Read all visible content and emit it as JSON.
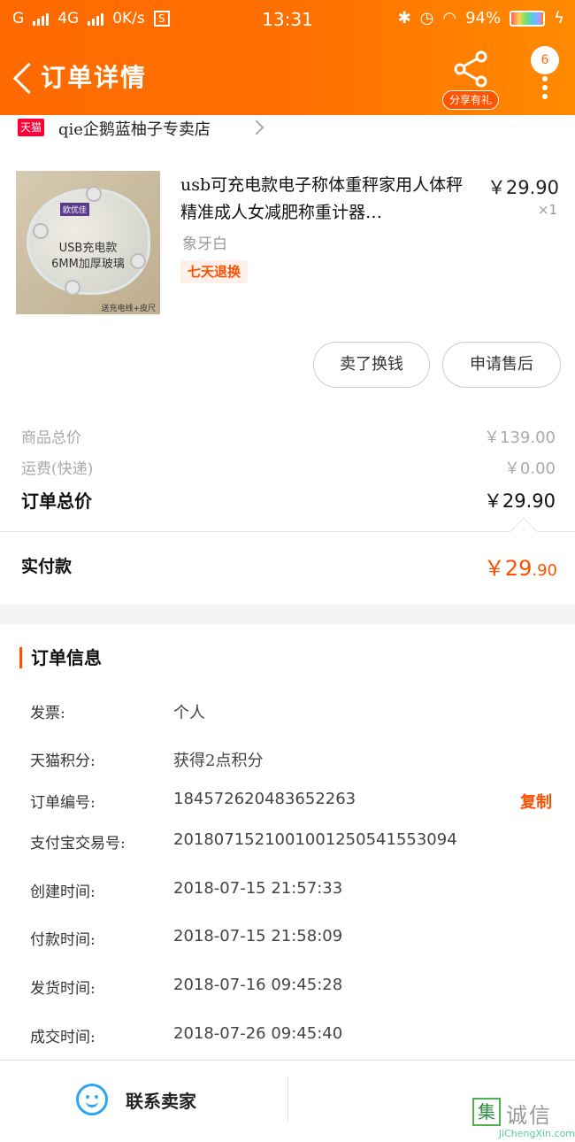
{
  "status_bar": {
    "carrier1": "G",
    "carrier2": "4G",
    "speed": "0K/s",
    "sim_badge": "S",
    "time": "13:31",
    "battery": "94%",
    "battery_level": 0.94
  },
  "header": {
    "title": "订单详情",
    "share_label": "分享有礼",
    "badge_count": "6"
  },
  "shop": {
    "logo_text": "天猫",
    "name": "qie企鹅蓝柚子专卖店"
  },
  "product": {
    "image_badge": "欧优佳",
    "image_line1": "USB充电款",
    "image_line2": "6MM加厚玻璃",
    "image_caption": "送充电线+皮尺",
    "title": "usb可充电款电子称体重秤家用人体秤精准成人女减肥称重计器…",
    "price": "￥29.90",
    "qty": "×1",
    "spec": "象牙白",
    "tag": "七天退换"
  },
  "actions": {
    "sell_label": "卖了换钱",
    "after_sale_label": "申请售后"
  },
  "summary": {
    "goods_total_label": "商品总价",
    "goods_total_value": "￥139.00",
    "shipping_label": "运费(快递)",
    "shipping_value": "￥0.00",
    "order_total_label": "订单总价",
    "order_total_value": "￥29.90",
    "paid_label": "实付款",
    "paid_value_main": "￥29",
    "paid_value_decimal": ".90"
  },
  "order_info": {
    "heading": "订单信息",
    "invoice_label": "发票:",
    "invoice_value": "个人",
    "points_label": "天猫积分:",
    "points_value": "获得2点积分",
    "order_no_label": "订单编号:",
    "order_no_value": "184572620483652263",
    "copy_label": "复制",
    "alipay_label": "支付宝交易号:",
    "alipay_value": "2018071521001001250541553094",
    "created_label": "创建时间:",
    "created_value": "2018-07-15 21:57:33",
    "paid_time_label": "付款时间:",
    "paid_time_value": "2018-07-15 21:58:09",
    "shipped_label": "发货时间:",
    "shipped_value": "2018-07-16 09:45:28",
    "completed_label": "成交时间:",
    "completed_value": "2018-07-26 09:45:40"
  },
  "bottom": {
    "contact_label": "联系卖家",
    "watermark_badge": "集",
    "watermark_name": "诚信",
    "watermark_url": "JiChengXin.com"
  },
  "colors": {
    "header_start": "#ff6a00",
    "accent": "#ff5000",
    "contact_icon": "#2ba6f0"
  }
}
